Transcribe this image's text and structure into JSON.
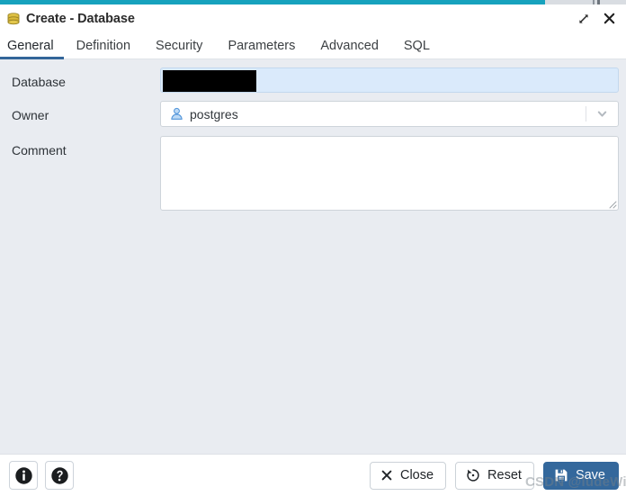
{
  "window": {
    "title": "Create - Database",
    "title_icon": "database-icon",
    "expand_icon": "expand-arrows-icon",
    "close_icon": "close-icon",
    "accent_color": "#17a2bd",
    "progress_percent": 87
  },
  "tabs": [
    {
      "label": "General",
      "active": true
    },
    {
      "label": "Definition",
      "active": false
    },
    {
      "label": "Security",
      "active": false
    },
    {
      "label": "Parameters",
      "active": false
    },
    {
      "label": "Advanced",
      "active": false
    },
    {
      "label": "SQL",
      "active": false
    }
  ],
  "tab_active_color": "#336699",
  "form": {
    "database": {
      "label": "Database",
      "value": "",
      "placeholder": "",
      "redacted": true,
      "required_highlight_color": "#daeafb"
    },
    "owner": {
      "label": "Owner",
      "value": "postgres",
      "icon": "user-icon",
      "caret_icon": "chevron-down-icon"
    },
    "comment": {
      "label": "Comment",
      "value": "",
      "placeholder": ""
    }
  },
  "footer": {
    "info_button": {
      "name": "info-button",
      "icon": "info-circle-icon",
      "label": ""
    },
    "help_button": {
      "name": "help-button",
      "icon": "question-circle-icon",
      "label": ""
    },
    "close_button": {
      "label": "Close",
      "icon": "close-x-icon"
    },
    "reset_button": {
      "label": "Reset",
      "icon": "reset-circle-arrow-icon"
    },
    "save_button": {
      "label": "Save",
      "icon": "save-floppy-icon",
      "color": "#34689c"
    }
  },
  "watermark": {
    "text": "CSDN @ludeWig"
  }
}
